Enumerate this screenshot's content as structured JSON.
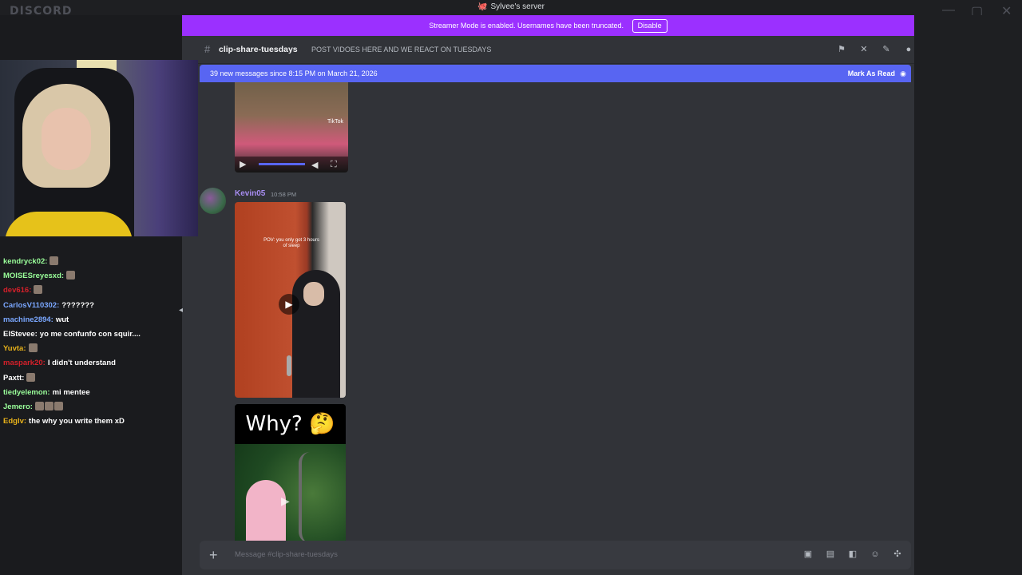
{
  "app": {
    "brand": "DISCORD",
    "server_title": "Sylvee's server",
    "server_emoji": "🐙"
  },
  "window_controls": {
    "minimize": "—",
    "maximize": "▢",
    "close": "✕"
  },
  "streamer_banner": {
    "text": "Streamer Mode is enabled. Usernames have been truncated.",
    "button": "Disable",
    "color": "#9b30ff"
  },
  "channel": {
    "hash": "#",
    "name": "clip-share-tuesdays",
    "topic": "POST VIDOES HERE AND WE REACT ON TUESDAYS"
  },
  "header_icons": [
    "threads-icon",
    "mute-icon",
    "pinned-icon",
    "members-icon"
  ],
  "new_messages_bar": {
    "text": "39 new messages since 8:15 PM on March 21, 2026",
    "action": "Mark As Read",
    "color": "#5865f2"
  },
  "messages": [
    {
      "author": "Kevin05",
      "time": "10:58 PM"
    }
  ],
  "videos": {
    "clip2_caption": "POV: you only got 3 hours of sleep",
    "clip3_title": "Why? 🤔",
    "tiktok_label": "TikTok"
  },
  "composer": {
    "placeholder": "Message #clip-share-tuesdays",
    "plus": "+"
  },
  "stream_chat": [
    {
      "name": "kendryck02:",
      "color": "#9aff9a",
      "msg": "",
      "emotes": 1
    },
    {
      "name": "MOISESreyesxd:",
      "color": "#9aff9a",
      "msg": "",
      "emotes": 1
    },
    {
      "name": "dev616:",
      "color": "#d4202a",
      "msg": "",
      "emotes": 1
    },
    {
      "name": "CarlosV110302:",
      "color": "#7aa7ff",
      "msg": "???????",
      "emotes": 0
    },
    {
      "name": "machine2894:",
      "color": "#7aa7ff",
      "msg": "wut",
      "emotes": 0
    },
    {
      "name": "ElStevee:",
      "color": "#ffffff",
      "msg": "yo me confunfo con squir....",
      "emotes": 0
    },
    {
      "name": "Yuvta:",
      "color": "#e8b21a",
      "msg": "",
      "emotes": 1
    },
    {
      "name": "maspark20:",
      "color": "#d4202a",
      "msg": "I didn't understand",
      "emotes": 0
    },
    {
      "name": "Paxtt:",
      "color": "#ffffff",
      "msg": "",
      "emotes": 1
    },
    {
      "name": "tiedyelemon:",
      "color": "#9aff9a",
      "msg": "mi mentee",
      "emotes": 0
    },
    {
      "name": "Jemero:",
      "color": "#9aff9a",
      "msg": "",
      "emotes": 3
    },
    {
      "name": "Edglv:",
      "color": "#e8b21a",
      "msg": "the why you write them xD",
      "emotes": 0
    }
  ]
}
